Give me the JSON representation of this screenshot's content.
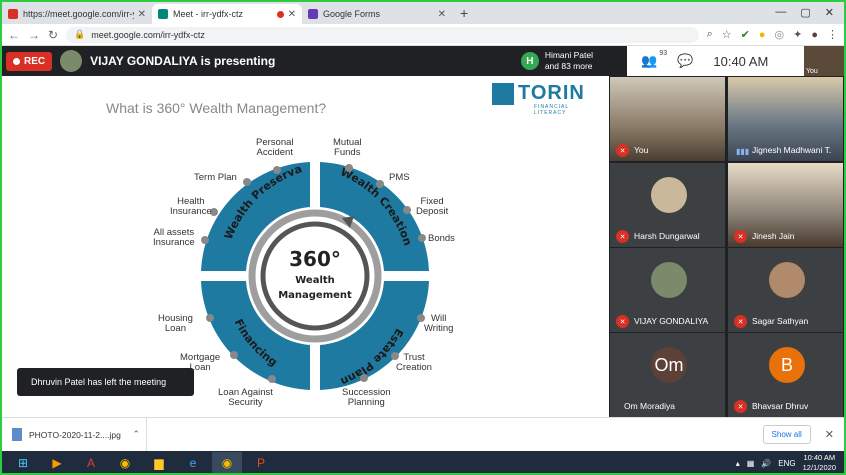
{
  "browser": {
    "tabs": [
      {
        "title": "https://meet.google.com/irr-ydfx",
        "favicon_color": "#d93025",
        "active": false
      },
      {
        "title": "Meet - irr-ydfx-ctz",
        "favicon_color": "#00897b",
        "active": true
      },
      {
        "title": "Google Forms",
        "favicon_color": "#673ab7",
        "active": false
      }
    ],
    "new_tab": "+",
    "window_controls": [
      "—",
      "▢",
      "✕"
    ],
    "url": "meet.google.com/irr-ydfx-ctz"
  },
  "meet": {
    "rec_label": "REC",
    "presenting": "VIJAY GONDALIYA is presenting",
    "others_initial": "H",
    "others_line1": "Himani Patel",
    "others_line2": "and 83 more",
    "participant_count": "93",
    "clock": "10:40 AM",
    "self_label": "You"
  },
  "slide": {
    "title": "What is 360° Wealth Management?",
    "logo_name": "TORIN",
    "logo_sub": "FINANCIAL LITERACY",
    "center_big": "360°",
    "center_line1": "Wealth",
    "center_line2": "Management",
    "quadrants": [
      "Wealth Preservation",
      "Wealth Creation",
      "Estate Planning",
      "Financing"
    ],
    "labels": {
      "personal_accident": "Personal\nAccident",
      "mutual_funds": "Mutual\nFunds",
      "term_plan": "Term Plan",
      "pms": "PMS",
      "health_insurance": "Health\nInsurance",
      "fixed_deposit": "Fixed\nDeposit",
      "all_assets_insurance": "All assets\nInsurance",
      "bonds": "Bonds",
      "housing_loan": "Housing\nLoan",
      "will_writing": "Will\nWriting",
      "mortgage_loan": "Mortgage\nLoan",
      "trust_creation": "Trust\nCreation",
      "loan_against_security": "Loan Against\nSecurity",
      "succession_planning": "Succession\nPlanning"
    }
  },
  "participants": [
    {
      "name": "You",
      "muted": true,
      "type": "video",
      "bg": "#8a7a66"
    },
    {
      "name": "Jignesh Madhwani T.",
      "muted": false,
      "type": "video",
      "bg": "#6c7a86"
    },
    {
      "name": "Harsh Dungarwal",
      "muted": true,
      "type": "photo",
      "bg": "#c9b99a"
    },
    {
      "name": "Jinesh Jain",
      "muted": true,
      "type": "video",
      "bg": "#8c8276"
    },
    {
      "name": "VIJAY GONDALIYA",
      "muted": true,
      "type": "photo",
      "bg": "#7a8a6a"
    },
    {
      "name": "Sagar Sathyan",
      "muted": true,
      "type": "photo",
      "bg": "#b08a6a"
    },
    {
      "name": "Om Moradiya",
      "muted": false,
      "type": "initials",
      "initials": "Om",
      "bg": "#5d4037"
    },
    {
      "name": "Bhavsar Dhruv",
      "muted": true,
      "type": "initials",
      "initials": "B",
      "bg": "#e8710a"
    }
  ],
  "toast": "Dhruvin Patel has left the meeting",
  "downloads": {
    "file": "PHOTO-2020-11-2....jpg",
    "show_all": "Show all"
  },
  "taskbar": {
    "lang": "ENG",
    "time": "10:40 AM",
    "date": "12/1/2020"
  },
  "colors": {
    "accent": "#1e7aa0",
    "meet_dark": "#202124",
    "muted_red": "#d93025"
  }
}
